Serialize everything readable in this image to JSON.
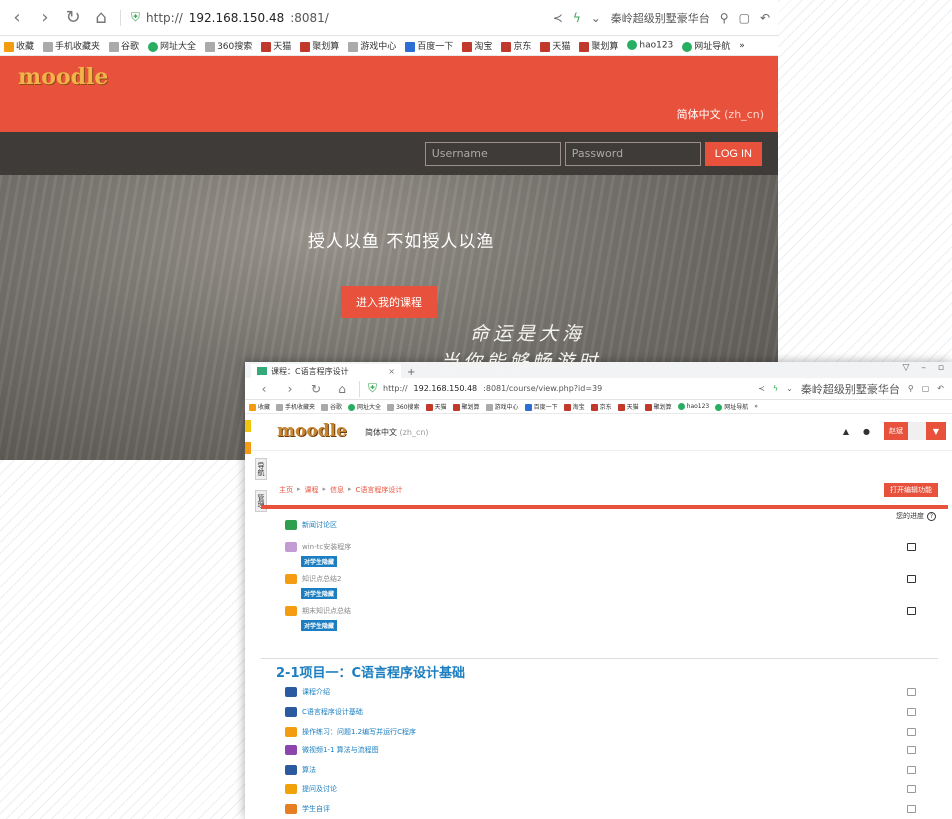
{
  "win1": {
    "url_prefix": "http://",
    "url_host": "192.168.150.48",
    "url_rest": ":8081/",
    "search_text": "秦岭超级别墅豪华台",
    "bookmarks": [
      {
        "label": "收藏",
        "icon": "star"
      },
      {
        "label": "手机收藏夹",
        "icon": "gray"
      },
      {
        "label": "谷歌",
        "icon": "gray"
      },
      {
        "label": "网址大全",
        "icon": "green"
      },
      {
        "label": "360搜索",
        "icon": "gray"
      },
      {
        "label": "天猫",
        "icon": "red"
      },
      {
        "label": "聚划算",
        "icon": "red"
      },
      {
        "label": "游戏中心",
        "icon": "gray"
      },
      {
        "label": "百度一下",
        "icon": "blue"
      },
      {
        "label": "淘宝",
        "icon": "red"
      },
      {
        "label": "京东",
        "icon": "red"
      },
      {
        "label": "天猫",
        "icon": "red"
      },
      {
        "label": "聚划算",
        "icon": "red"
      },
      {
        "label": "hao123",
        "icon": "green"
      },
      {
        "label": "网址导航",
        "icon": "green"
      },
      {
        "label": "»",
        "icon": ""
      }
    ],
    "logo": "moodle",
    "language": "简体中文",
    "language_code": "(zh_cn)",
    "username_placeholder": "Username",
    "password_placeholder": "Password",
    "login_label": "LOG IN",
    "hero_title": "授人以鱼   不如授人以渔",
    "hero_button": "进入我的课程",
    "poem_line1": "命运是大海",
    "poem_line2": "当你能够畅游时"
  },
  "win2": {
    "tab_title": "课程：C语言程序设计",
    "url_prefix": "http://",
    "url_host": "192.168.150.48",
    "url_rest": ":8081/course/view.php?id=39",
    "search_text": "秦岭超级别墅豪华台",
    "bookmarks": [
      {
        "label": "收藏",
        "icon": "star"
      },
      {
        "label": "手机收藏夹",
        "icon": "gray"
      },
      {
        "label": "谷歌",
        "icon": "gray"
      },
      {
        "label": "网址大全",
        "icon": "green"
      },
      {
        "label": "360搜索",
        "icon": "gray"
      },
      {
        "label": "天猫",
        "icon": "red"
      },
      {
        "label": "聚划算",
        "icon": "red"
      },
      {
        "label": "游戏中心",
        "icon": "gray"
      },
      {
        "label": "百度一下",
        "icon": "blue"
      },
      {
        "label": "淘宝",
        "icon": "red"
      },
      {
        "label": "京东",
        "icon": "red"
      },
      {
        "label": "天猫",
        "icon": "red"
      },
      {
        "label": "聚划算",
        "icon": "red"
      },
      {
        "label": "hao123",
        "icon": "green"
      },
      {
        "label": "网址导航",
        "icon": "green"
      },
      {
        "label": "»",
        "icon": ""
      }
    ],
    "logo": "moodle",
    "language": "简体中文",
    "language_code": "(zh_cn)",
    "user_name": "赵斌",
    "side_tab_1": "导航",
    "side_tab_2": "管理",
    "breadcrumb": [
      "主页",
      "课程",
      "信息",
      "C语言程序设计"
    ],
    "edit_button": "打开编辑功能",
    "progress_label": "您的进度",
    "top_activities": [
      {
        "label": "新闻讨论区",
        "icon": "forum-icon",
        "color": "#2e9e4f",
        "tag": ""
      },
      {
        "label": "win-tc安装程序",
        "icon": "resource-icon",
        "color": "#c39bd3",
        "tag": "对学生隐藏"
      },
      {
        "label": "知识点总结2",
        "icon": "hand-icon",
        "color": "#f39c12",
        "tag": "对学生隐藏"
      },
      {
        "label": "期末知识点总结",
        "icon": "hand-icon",
        "color": "#f39c12",
        "tag": "对学生隐藏"
      }
    ],
    "section_title": "2-1项目一：C语言程序设计基础",
    "section_activities": [
      {
        "label": "课程介绍",
        "icon": "page-icon",
        "color": "#2c5aa0"
      },
      {
        "label": "C语言程序设计基础",
        "icon": "page-icon",
        "color": "#2c5aa0"
      },
      {
        "label": "操作练习：问题1.2编写并运行C程序",
        "icon": "hand-icon",
        "color": "#f39c12"
      },
      {
        "label": "微视频1-1 算法与流程图",
        "icon": "video-icon",
        "color": "#8e44ad"
      },
      {
        "label": "算法",
        "icon": "page-icon",
        "color": "#2c5aa0"
      },
      {
        "label": "提问及讨论",
        "icon": "chat-icon",
        "color": "#f1a10a"
      },
      {
        "label": "学生自评",
        "icon": "feedback-icon",
        "color": "#e67e22"
      }
    ],
    "colors": {
      "brand": "#e8523c",
      "link": "#1a7ec0",
      "tag": "#1a7ec0"
    }
  }
}
